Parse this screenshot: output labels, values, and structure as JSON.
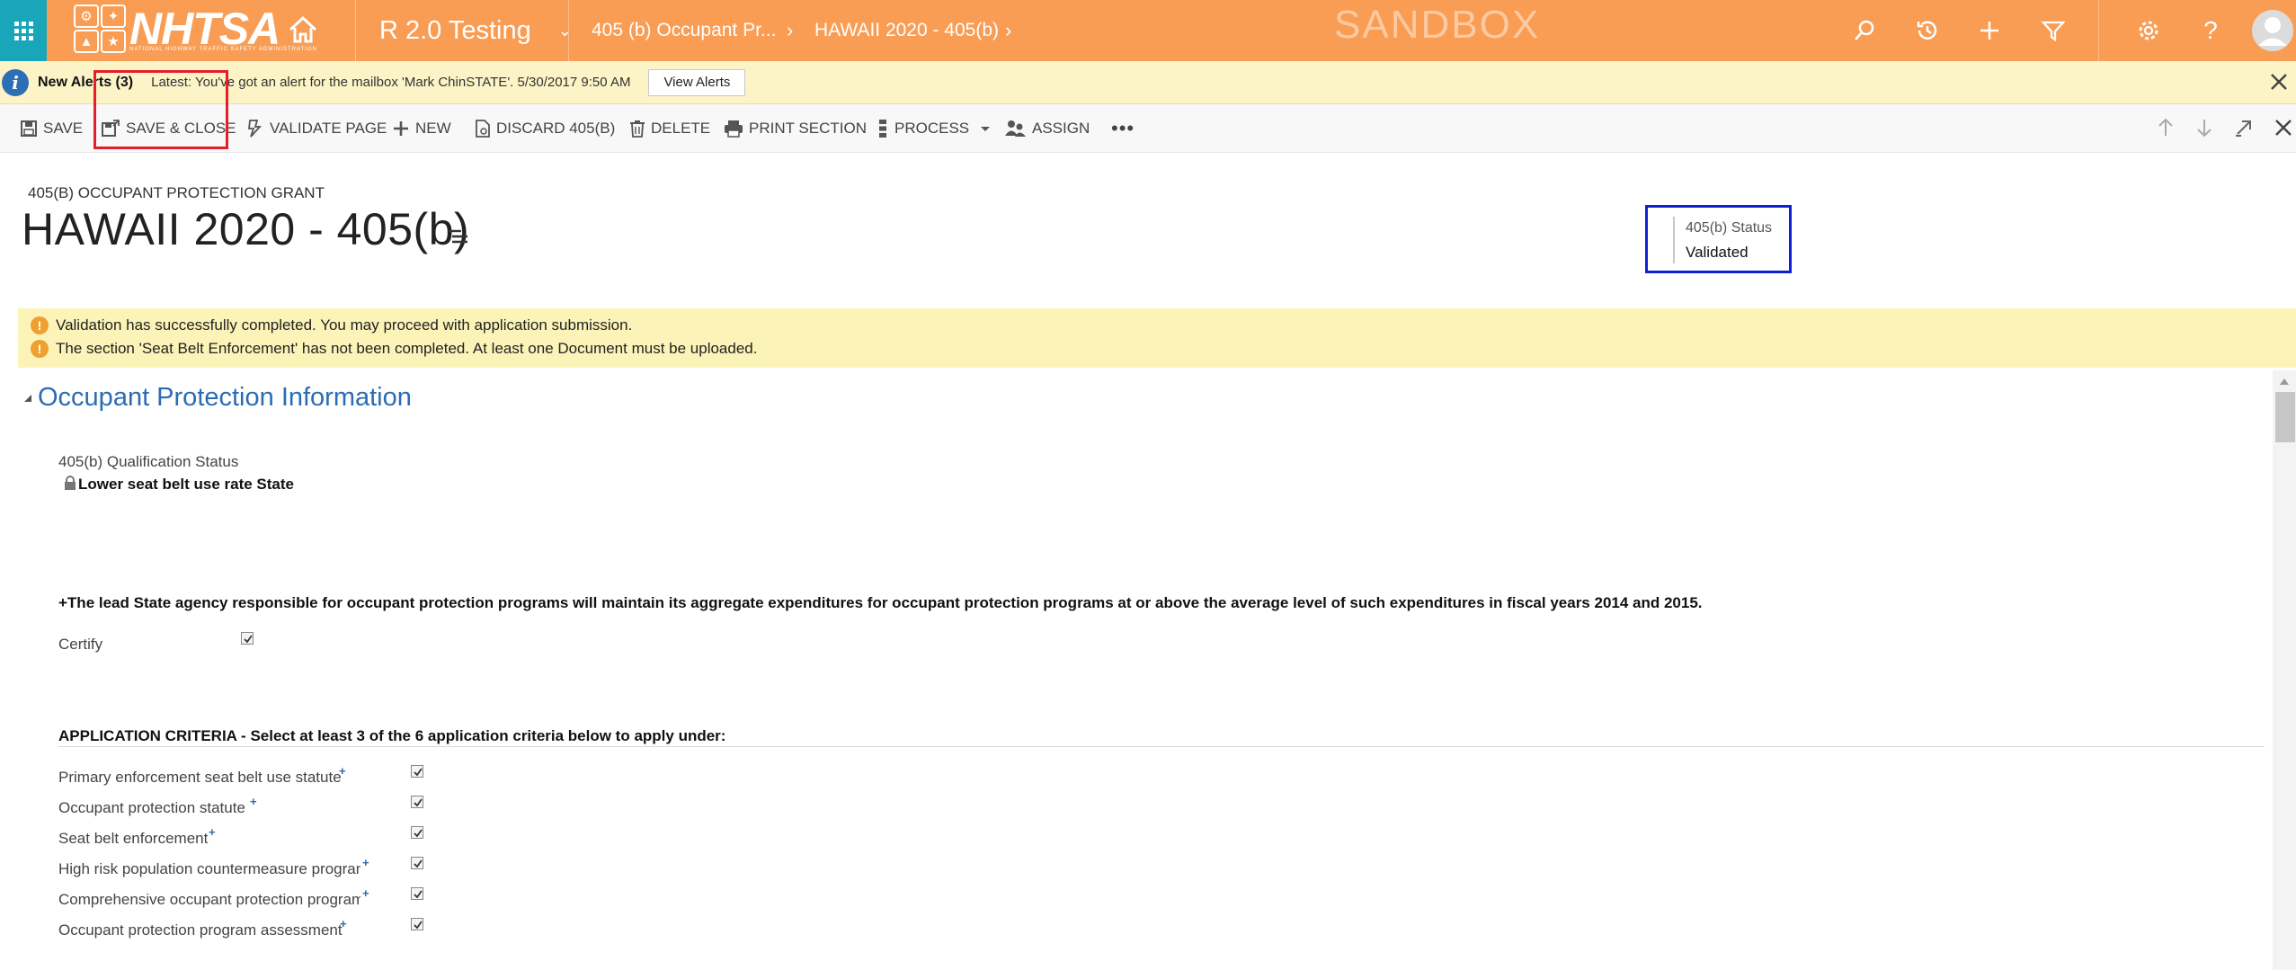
{
  "topnav": {
    "logo_text": "NHTSA",
    "logo_subtitle": "NATIONAL HIGHWAY TRAFFIC SAFETY ADMINISTRATION",
    "app_name": "R 2.0 Testing",
    "breadcrumb_1": "405 (b) Occupant Pr...",
    "breadcrumb_2": "HAWAII 2020 - 405(b)",
    "environment_label": "SANDBOX",
    "icons": [
      "search-icon",
      "recent-icon",
      "create-icon",
      "filter-icon",
      "settings-icon",
      "help-icon",
      "user-avatar"
    ],
    "bg_color": "#f99d55",
    "waffle_color": "#1aa6ba"
  },
  "alerts": {
    "title": "New Alerts (3)",
    "message": "Latest: You've got an alert for the mailbox 'Mark ChinSTATE'. 5/30/2017 9:50 AM",
    "button_label": "View Alerts"
  },
  "commands": {
    "save": "SAVE",
    "save_close": "SAVE & CLOSE",
    "validate": "VALIDATE PAGE",
    "new": "NEW",
    "discard": "DISCARD 405(B)",
    "delete": "DELETE",
    "print": "PRINT SECTION",
    "process": "PROCESS",
    "assign": "ASSIGN"
  },
  "header": {
    "form_type": "405(B) OCCUPANT PROTECTION GRANT",
    "title": "HAWAII 2020 - 405(b)",
    "status_label": "405(b) Status",
    "status_value": "Validated"
  },
  "notifications": [
    "Validation has successfully completed. You may proceed with application submission.",
    "The section 'Seat Belt Enforcement' has not been completed. At least one Document must be uploaded."
  ],
  "section": {
    "title": "Occupant Protection Information",
    "qual_label": "405(b) Qualification Status",
    "qual_value": "Lower seat belt use rate State",
    "statement": "+The lead State agency responsible for occupant protection programs will maintain its aggregate expenditures for occupant protection programs at or above the average level of such expenditures in fiscal years 2014 and 2015.",
    "certify_label": "Certify",
    "certify_checked": true,
    "criteria_heading": "APPLICATION CRITERIA - Select at least 3 of the 6 application criteria below to apply under:",
    "criteria": [
      {
        "label": "Primary enforcement seat belt use statute",
        "checked": true
      },
      {
        "label": "Occupant protection statute",
        "checked": true
      },
      {
        "label": "Seat belt enforcement",
        "checked": true
      },
      {
        "label": "High risk population countermeasure program",
        "checked": true
      },
      {
        "label": "Comprehensive occupant protection program",
        "checked": true
      },
      {
        "label": "Occupant protection program assessment",
        "checked": true
      }
    ]
  }
}
